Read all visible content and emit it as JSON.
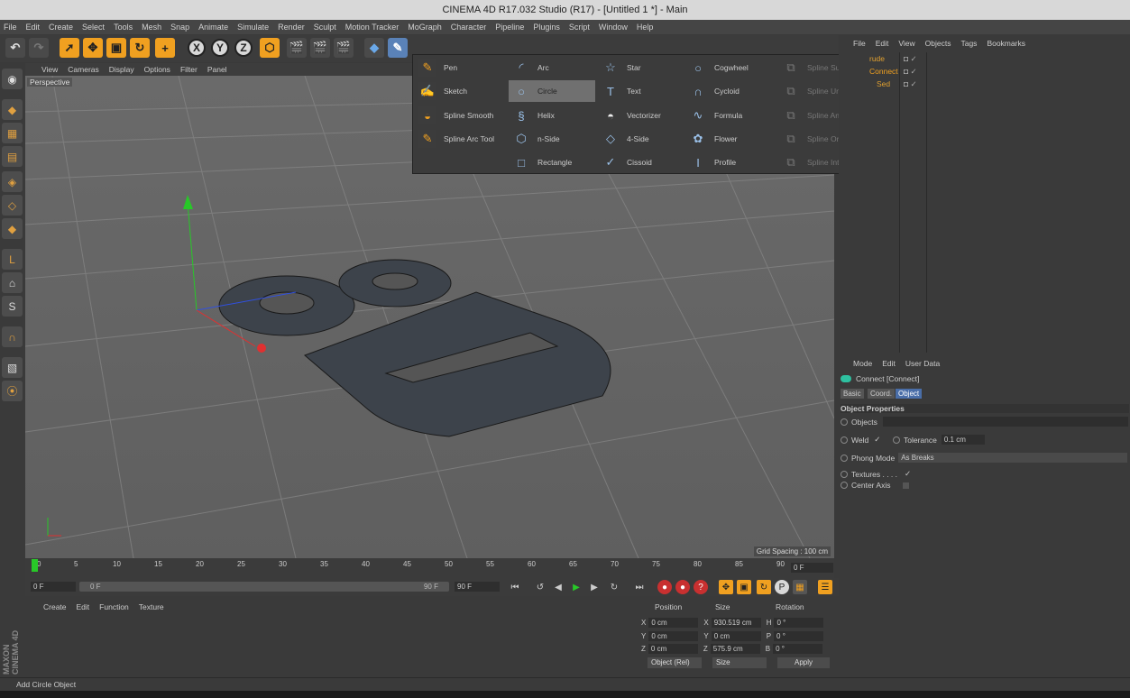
{
  "window": {
    "title": "CINEMA 4D R17.032 Studio (R17) - [Untitled 1 *] - Main"
  },
  "menubar": [
    "File",
    "Edit",
    "Create",
    "Select",
    "Tools",
    "Mesh",
    "Snap",
    "Animate",
    "Simulate",
    "Render",
    "Sculpt",
    "Motion Tracker",
    "MoGraph",
    "Character",
    "Pipeline",
    "Plugins",
    "Script",
    "Window",
    "Help"
  ],
  "toolbar": {
    "axis_x": "X",
    "axis_y": "Y",
    "axis_z": "Z"
  },
  "viewport": {
    "menu": [
      "View",
      "Cameras",
      "Display",
      "Options",
      "Filter",
      "Panel"
    ],
    "camera_label": "Perspective",
    "grid_spacing": "Grid Spacing : 100 cm"
  },
  "spline_popup": {
    "col1": [
      {
        "label": "Pen",
        "icon": "pen-icon"
      },
      {
        "label": "Sketch",
        "icon": "sketch-icon"
      },
      {
        "label": "Spline Smooth",
        "icon": "spline-smooth-icon"
      },
      {
        "label": "Spline Arc Tool",
        "icon": "spline-arc-tool-icon"
      }
    ],
    "col2": [
      {
        "label": "Arc",
        "icon": "arc-icon"
      },
      {
        "label": "Circle",
        "icon": "circle-icon"
      },
      {
        "label": "Helix",
        "icon": "helix-icon"
      },
      {
        "label": "n-Side",
        "icon": "n-side-icon"
      },
      {
        "label": "Rectangle",
        "icon": "rectangle-icon"
      }
    ],
    "col3": [
      {
        "label": "Star",
        "icon": "star-icon"
      },
      {
        "label": "Text",
        "icon": "text-icon"
      },
      {
        "label": "Vectorizer",
        "icon": "vectorizer-icon"
      },
      {
        "label": "4-Side",
        "icon": "four-side-icon"
      },
      {
        "label": "Cissoid",
        "icon": "cissoid-icon"
      }
    ],
    "col4": [
      {
        "label": "Cogwheel",
        "icon": "cogwheel-icon"
      },
      {
        "label": "Cycloid",
        "icon": "cycloid-icon"
      },
      {
        "label": "Formula",
        "icon": "formula-icon"
      },
      {
        "label": "Flower",
        "icon": "flower-icon"
      },
      {
        "label": "Profile",
        "icon": "profile-icon"
      }
    ],
    "col5": [
      {
        "label": "Spline Subtract",
        "icon": "spline-subtract-icon"
      },
      {
        "label": "Spline Union",
        "icon": "spline-union-icon"
      },
      {
        "label": "Spline And",
        "icon": "spline-and-icon"
      },
      {
        "label": "Spline Or",
        "icon": "spline-or-icon"
      },
      {
        "label": "Spline Intersect",
        "icon": "spline-intersect-icon"
      }
    ]
  },
  "object_manager": {
    "menu": [
      "File",
      "Edit",
      "View",
      "Objects",
      "Tags",
      "Bookmarks"
    ],
    "rows": [
      "rude",
      "Connect",
      "Sed"
    ]
  },
  "attribute_manager": {
    "menu": [
      "Mode",
      "Edit",
      "User Data"
    ],
    "object_name": "Connect [Connect]",
    "tabs": [
      "Basic",
      "Coord.",
      "Object"
    ],
    "section": "Object Properties",
    "objects_label": "Objects",
    "weld_label": "Weld",
    "weld_check": "✓",
    "tolerance_label": "Tolerance",
    "tolerance_value": "0.1 cm",
    "phong_label": "Phong Mode",
    "phong_value": "As Breaks",
    "textures_label": "Textures . . . .",
    "textures_check": "✓",
    "center_axis_label": "Center Axis"
  },
  "timeline": {
    "ticks": [
      "0",
      "5",
      "10",
      "15",
      "20",
      "25",
      "30",
      "35",
      "40",
      "45",
      "50",
      "55",
      "60",
      "65",
      "70",
      "75",
      "80",
      "85",
      "90"
    ],
    "current_frame": "0 F",
    "start_frame": "0 F",
    "range_start": "0 F",
    "range_end": "90 F",
    "end_frame": "90 F"
  },
  "material_manager": {
    "menu": [
      "Create",
      "Edit",
      "Function",
      "Texture"
    ]
  },
  "coordinates": {
    "headers": [
      "Position",
      "Size",
      "Rotation"
    ],
    "rows": [
      {
        "axis": "X",
        "pos": "0 cm",
        "size_axis": "X",
        "size": "930.519 cm",
        "rot_axis": "H",
        "rot": "0 °"
      },
      {
        "axis": "Y",
        "pos": "0 cm",
        "size_axis": "Y",
        "size": "0 cm",
        "rot_axis": "P",
        "rot": "0 °"
      },
      {
        "axis": "Z",
        "pos": "0 cm",
        "size_axis": "Z",
        "size": "575.9 cm",
        "rot_axis": "B",
        "rot": "0 °"
      }
    ],
    "mode_dropdown": "Object (Rel)",
    "size_dropdown": "Size",
    "apply_label": "Apply"
  },
  "branding": "MAXON CINEMA 4D",
  "status": "Add Circle Object"
}
